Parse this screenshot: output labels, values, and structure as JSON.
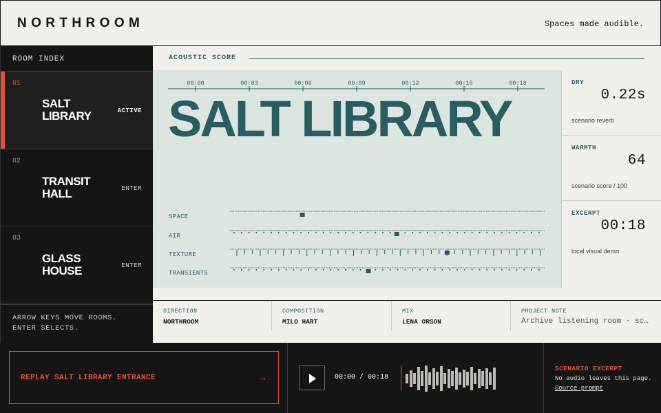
{
  "header": {
    "brand": "NORTHROOM",
    "tagline": "Spaces made audible."
  },
  "sidebar": {
    "title": "ROOM INDEX",
    "rooms": [
      {
        "num": "01",
        "name": "SALT LIBRARY",
        "state": "ACTIVE",
        "active": true
      },
      {
        "num": "02",
        "name": "TRANSIT HALL",
        "state": "ENTER",
        "active": false
      },
      {
        "num": "03",
        "name": "GLASS HOUSE",
        "state": "ENTER",
        "active": false
      }
    ],
    "hint_line1": "ARROW KEYS MOVE ROOMS.",
    "hint_line2": "ENTER SELECTS."
  },
  "score": {
    "label": "ACOUSTIC SCORE",
    "timeline": [
      "00:00",
      "00:03",
      "00:06",
      "00:09",
      "00:12",
      "00:15",
      "00:18"
    ],
    "hero_title": "SALT LIBRARY",
    "tracks": [
      {
        "label": "SPACE",
        "position": 0.23
      },
      {
        "label": "AIR",
        "position": 0.53
      },
      {
        "label": "TEXTURE",
        "position": 0.69
      },
      {
        "label": "TRANSIENTS",
        "position": 0.44
      }
    ]
  },
  "metrics": [
    {
      "label": "DRY",
      "value": "0.22s",
      "sub": "scenario reverb"
    },
    {
      "label": "WARMTH",
      "value": "64",
      "sub": "scenario score / 100"
    },
    {
      "label": "EXCERPT",
      "value": "00:18",
      "sub": "local visual demo"
    }
  ],
  "credits": [
    {
      "label": "DIRECTION",
      "value": "NORTHROOM"
    },
    {
      "label": "COMPOSITION",
      "value": "MILO HART"
    },
    {
      "label": "MIX",
      "value": "LENA ORSON"
    },
    {
      "label": "PROJECT NOTE",
      "value": "Archive listening room · sc…"
    }
  ],
  "player": {
    "replay_label": "REPLAY SALT LIBRARY ENTRANCE",
    "replay_arrow": "→",
    "time": "00:00 / 00:18",
    "waveform": [
      0.35,
      0.6,
      0.4,
      0.85,
      0.55,
      0.95,
      0.45,
      0.75,
      0.5,
      0.9,
      0.4,
      0.7,
      0.55,
      0.8,
      0.45,
      0.65,
      0.5,
      0.85,
      0.4,
      0.7,
      0.55,
      0.75,
      0.45,
      0.8
    ],
    "excerpt_title": "SCENARIO EXCERPT",
    "excerpt_note": "No audio leaves this page.",
    "excerpt_link": "Source prompt"
  },
  "colors": {
    "accent": "#e0533c",
    "teal": "#2a5d62",
    "dark": "#151515",
    "paper": "#f2f0eb",
    "score_bg": "#dde5e1"
  }
}
